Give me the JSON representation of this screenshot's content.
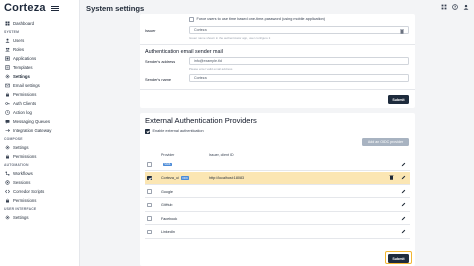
{
  "app": {
    "logo": "Corteza",
    "page_title": "System settings"
  },
  "sidebar": {
    "items": [
      {
        "label": "Dashboard",
        "icon": "dashboard-icon"
      },
      {
        "section": "SYSTEM"
      },
      {
        "label": "Users",
        "icon": "user-icon"
      },
      {
        "label": "Roles",
        "icon": "roles-icon"
      },
      {
        "label": "Applications",
        "icon": "applications-icon"
      },
      {
        "label": "Templates",
        "icon": "templates-icon"
      },
      {
        "label": "Settings",
        "icon": "settings-icon",
        "active": true
      },
      {
        "label": "Email settings",
        "icon": "email-icon"
      },
      {
        "label": "Permissions",
        "icon": "lock-icon"
      },
      {
        "label": "Auth Clients",
        "icon": "key-icon"
      },
      {
        "label": "Action log",
        "icon": "log-icon"
      },
      {
        "label": "Messaging Queues",
        "icon": "queue-icon"
      },
      {
        "label": "Integration Gateway",
        "icon": "gateway-icon"
      },
      {
        "section": "COMPOSE"
      },
      {
        "label": "Settings",
        "icon": "settings-icon"
      },
      {
        "label": "Permissions",
        "icon": "lock-icon"
      },
      {
        "section": "AUTOMATION"
      },
      {
        "label": "Workflows",
        "icon": "workflow-icon"
      },
      {
        "label": "Sessions",
        "icon": "sessions-icon"
      },
      {
        "label": "Corredor Scripts",
        "icon": "scripts-icon"
      },
      {
        "label": "Permissions",
        "icon": "lock-icon"
      },
      {
        "section": "USER INTERFACE"
      },
      {
        "label": "Settings",
        "icon": "settings-icon"
      }
    ]
  },
  "mfa": {
    "force_totp_label": "Force users to use time based one-time-password (using mobile application)",
    "issuer_label": "Issuer",
    "issuer_value": "Corteza",
    "issuer_hint": "Issuer name shown in the authenticator app, user configure it"
  },
  "sender": {
    "title": "Authentication email sender mail",
    "address_label": "Sender's address",
    "address_value": "info@example.tld",
    "address_hint": "Please enter valid email address",
    "name_label": "Sender's name",
    "name_value": "Corteza",
    "submit": "Submit"
  },
  "external": {
    "title": "External Authentication Providers",
    "enable_label": "Enable external authentication",
    "add_button": "Add an OIDC provider",
    "col_provider": "Provider",
    "col_issuer": "Issuer, client ID",
    "rows": [
      {
        "name": "",
        "badge": "SAML",
        "issuer": "",
        "checked": false,
        "highlight": false
      },
      {
        "name": "Corteza_ui",
        "badge": "OIDC",
        "issuer": "http://localhost:18083",
        "checked": true,
        "highlight": true
      },
      {
        "name": "Google",
        "badge": "",
        "issuer": "",
        "checked": false,
        "highlight": false
      },
      {
        "name": "GitHub",
        "badge": "",
        "issuer": "",
        "checked": false,
        "highlight": false
      },
      {
        "name": "Facebook",
        "badge": "",
        "issuer": "",
        "checked": false,
        "highlight": false
      },
      {
        "name": "LinkedIn",
        "badge": "",
        "issuer": "",
        "checked": false,
        "highlight": false
      }
    ],
    "submit": "Submit"
  },
  "colors": {
    "primary": "#1e2b3c",
    "highlight": "#fbe6b3",
    "focus": "#f2b632",
    "badge": "#4b8bd8"
  }
}
